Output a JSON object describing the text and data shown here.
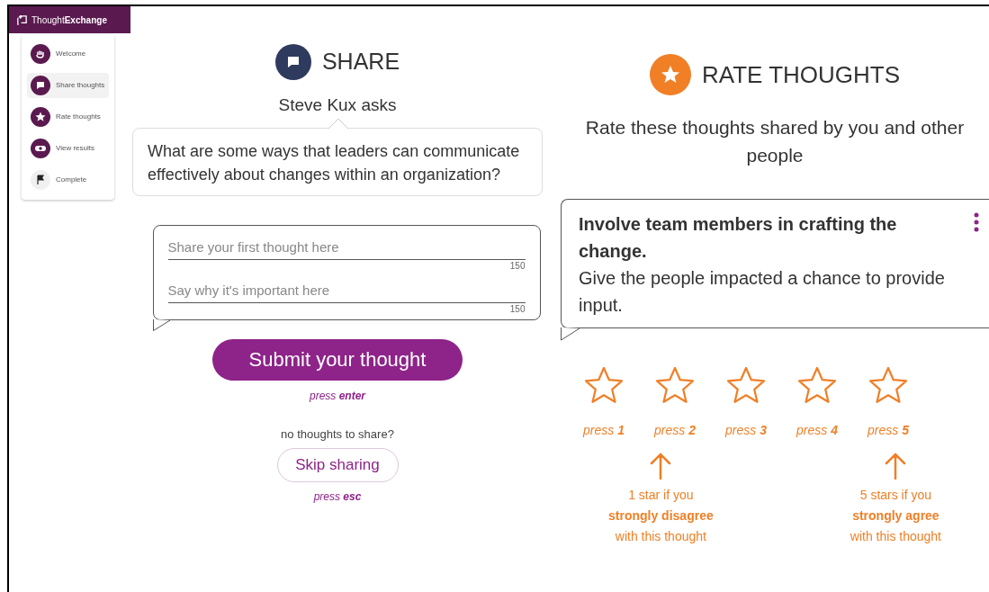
{
  "brand": "Thought**Exchange**",
  "steps": [
    {
      "label": "Welcome",
      "kind": "hand",
      "selected": false
    },
    {
      "label": "Share thoughts",
      "kind": "chat",
      "selected": true
    },
    {
      "label": "Rate thoughts",
      "kind": "star",
      "selected": false
    },
    {
      "label": "View results",
      "kind": "eye",
      "selected": false
    },
    {
      "label": "Complete",
      "kind": "flag",
      "selected": false
    }
  ],
  "share": {
    "title": "SHARE",
    "asker": "Steve Kux asks",
    "question": "What are some ways that leaders can communicate effectively about changes within an organization?",
    "fields": [
      {
        "placeholder": "Share your first thought here",
        "counter": "150"
      },
      {
        "placeholder": "Say why it's important here",
        "counter": "150"
      }
    ],
    "submit": "Submit your thought",
    "submit_hint": "press **enter**",
    "skip_prompt": "no thoughts to share?",
    "skip": "Skip sharing",
    "skip_hint": "press **esc**"
  },
  "rate": {
    "title": "RATE THOUGHTS",
    "intro": "Rate these thoughts shared by you and other people",
    "thought_title": "Involve team members in crafting the change.",
    "thought_body": "Give the people impacted a chance to provide input.",
    "stars": 0,
    "star_labels": [
      "press **1**",
      "press **2**",
      "press **3**",
      "press **4**",
      "press **5**"
    ],
    "hints": [
      "1 star if you\n**strongly disagree**\nwith this thought",
      "5 stars if you\n**strongly agree**\nwith this thought"
    ]
  }
}
